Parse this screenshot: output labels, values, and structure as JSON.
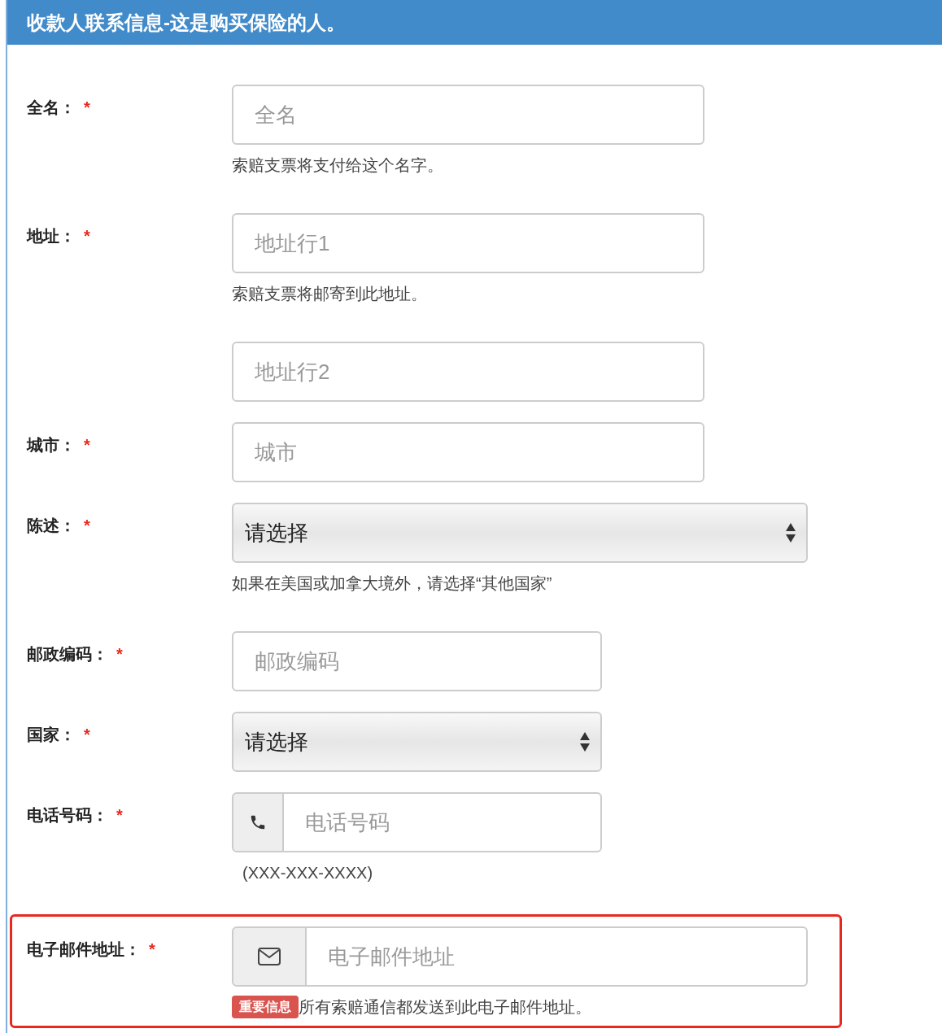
{
  "header": {
    "title": "收款人联系信息-这是购买保险的人。"
  },
  "fields": [
    {
      "kind": "text",
      "label": "全名：",
      "marker": "*",
      "placeholder": "全名",
      "hint": "索赔支票将支付给这个名字。",
      "highlighted": false
    },
    {
      "kind": "text",
      "label": "地址：",
      "marker": "*",
      "placeholder": "地址行1",
      "hint": "索赔支票将邮寄到此地址。",
      "highlighted": false
    },
    {
      "kind": "text",
      "placeholder": "地址行2",
      "highlighted": false
    },
    {
      "kind": "text",
      "label": "城市：",
      "marker": "*",
      "placeholder": "城市",
      "highlighted": false
    },
    {
      "kind": "select",
      "label": "陈述：",
      "marker": "*",
      "value": "请选择",
      "hint": "如果在美国或加拿大境外，请选择“其他国家”",
      "highlighted": false
    },
    {
      "kind": "short-text",
      "label": "邮政编码：",
      "marker": "*",
      "placeholder": "邮政编码",
      "highlighted": false
    },
    {
      "kind": "short-select",
      "label": "国家：",
      "marker": "*",
      "value": "请选择",
      "highlighted": false
    },
    {
      "kind": "phone",
      "label": "电话号码：",
      "marker": "*",
      "placeholder": "电话号码",
      "hint": "(XXX-XXX-XXXX)",
      "highlighted": false
    },
    {
      "kind": "email",
      "label": "电子邮件地址：",
      "marker": "*",
      "placeholder": "电子邮件地址",
      "badge": "重要信息",
      "hint": "所有索赔通信都发送到此电子邮件地址。",
      "highlighted": true
    }
  ]
}
